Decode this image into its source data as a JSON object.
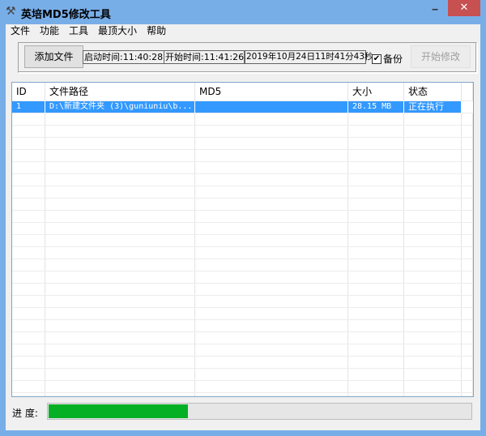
{
  "window": {
    "title": "英培MD5修改工具",
    "minimize": "‒",
    "close": "✕",
    "app_icon": "tools-icon"
  },
  "menu": [
    "文件",
    "功能",
    "工具",
    "最顶大小",
    "帮助"
  ],
  "toolbar": {
    "add_file": "添加文件",
    "launch_time": "启动时间:11:40:28",
    "start_time": "开始时间:11:41:26",
    "current_time": "2019年10月24日11时41分43秒",
    "backup_label": "备份",
    "backup_checked": true,
    "start_modify": "开始修改"
  },
  "table": {
    "columns": [
      "ID",
      "文件路径",
      "MD5",
      "大小",
      "状态"
    ],
    "rows": [
      {
        "id": "1",
        "path": "D:\\新建文件夹 (3)\\guniuniu\\b...",
        "md5": "",
        "size": "28.15 MB",
        "status": "正在执行",
        "selected": true
      }
    ]
  },
  "progress": {
    "label": "进 度:",
    "percent": 33,
    "color": "#06b025"
  }
}
